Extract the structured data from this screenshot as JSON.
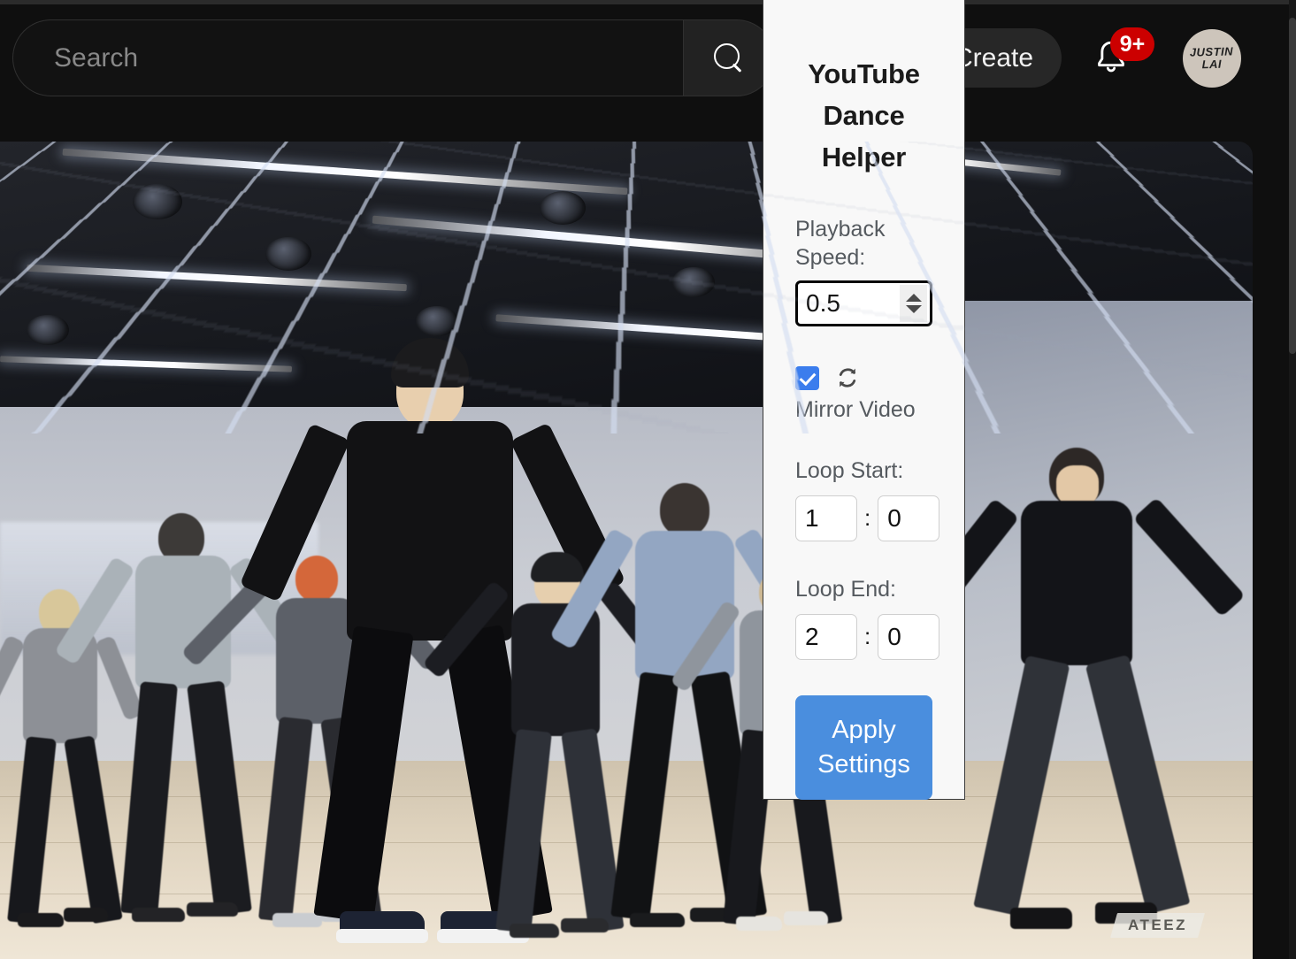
{
  "browser": {
    "scrollbar": "vertical-scrollbar"
  },
  "youtube_header": {
    "search": {
      "placeholder": "Search",
      "value": "",
      "button_icon": "search-icon"
    },
    "create_label": "Create",
    "notifications": {
      "icon": "bell-icon",
      "badge_count": "9+",
      "badge_color": "#cc0000"
    },
    "avatar": {
      "line1": "JUSTIN",
      "line2": "LAI",
      "bg_color": "#cdc5bb"
    }
  },
  "video": {
    "watermark": "ATEEZ"
  },
  "extension_panel": {
    "title": "YouTube Dance Helper",
    "playback_speed": {
      "label": "Playback Speed:",
      "value": "0.5",
      "spinner_up_icon": "triangle-up-icon",
      "spinner_down_icon": "triangle-down-icon"
    },
    "mirror": {
      "label": "Mirror Video",
      "checked": true,
      "icon": "refresh-sync-icon",
      "checkbox_color": "#3b7ded"
    },
    "loop_start": {
      "label": "Loop Start:",
      "minutes": "1",
      "separator": ":",
      "seconds": "0"
    },
    "loop_end": {
      "label": "Loop End:",
      "minutes": "2",
      "separator": ":",
      "seconds": "0"
    },
    "apply_button": {
      "label": "Apply Settings",
      "color": "#4a8ede"
    }
  }
}
